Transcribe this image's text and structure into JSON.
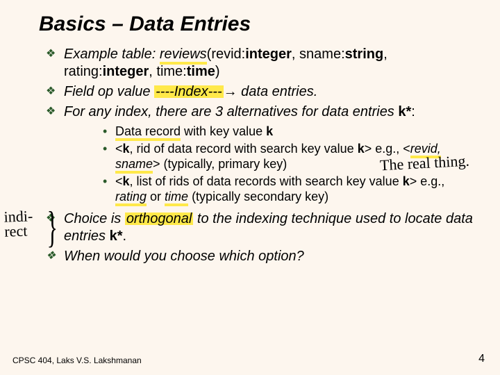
{
  "title": "Basics – Data Entries",
  "bullets": {
    "b1_pre": "Example table: ",
    "b1_rev": "reviews",
    "b1_a": "(revid:",
    "b1_int1": "integer",
    "b1_b": ", sname:",
    "b1_str": "string",
    "b1_c": ", rating:",
    "b1_int2": "integer",
    "b1_d": ",  time:",
    "b1_time": "time",
    "b1_e": ")",
    "b2_a": "Field op value ",
    "b2_idx": "----Index---",
    "b2_arrow": "→",
    "b2_b": " data entries.",
    "b3_a": "For any index, there are 3 alternatives for data entries ",
    "b3_k": "k*",
    "b3_c": ":",
    "s1_a": "Data record",
    "s1_b": " with key value ",
    "s1_k": "k",
    "s2_a": "<",
    "s2_k1": "k",
    "s2_b": ", rid of data record with search key value ",
    "s2_k2": "k",
    "s2_c": "> e.g., <",
    "s2_rev": "revid, sname",
    "s2_d": "> (typically, primary key)",
    "s3_a": "<",
    "s3_k1": "k",
    "s3_b": ", list of rids of data records with search key value ",
    "s3_k2": "k",
    "s3_c": "> e.g., ",
    "s3_rat": "rating",
    "s3_d": " or ",
    "s3_tim": "time",
    "s3_e": " (typically secondary key)",
    "b4_a": "Choice is ",
    "b4_orth": "orthogonal",
    "b4_b": " to the ",
    "b4_idx": "indexing technique",
    "b4_c": " used to locate data entries ",
    "b4_k": "k*",
    "b4_d": ".",
    "b5": "When would you choose which option?"
  },
  "handwriting": {
    "real": "The real thing.",
    "indirect1": "indi-",
    "indirect2": "rect",
    "brace": "}"
  },
  "footer": {
    "left": "CPSC 404, Laks V.S. Lakshmanan",
    "right": "4"
  }
}
